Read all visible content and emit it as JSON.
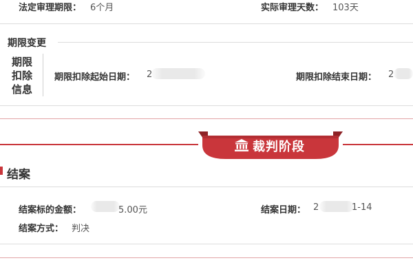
{
  "top": {
    "legal_period_label": "法定审理期限：",
    "legal_period_value": "6个月",
    "actual_days_label": "实际审理天数：",
    "actual_days_value": "103天"
  },
  "period_change": {
    "title": "期限变更",
    "side_label": [
      "期限",
      "扣除",
      "信息"
    ],
    "deduct_start_label": "期限扣除起始日期：",
    "deduct_start_value": "2",
    "deduct_end_label": "期限扣除结束日期：",
    "deduct_end_value": "2"
  },
  "stage_banner": {
    "label": "裁判阶段",
    "icon": "courthouse-icon"
  },
  "closing": {
    "title": "结案",
    "amount_label": "结案标的金额：",
    "amount_value_tail": "5.00元",
    "date_label": "结案日期：",
    "date_value_head": "2",
    "date_value_tail": "1-14",
    "method_label": "结案方式：",
    "method_value": "判决"
  },
  "colors": {
    "accent_red": "#c9363b",
    "banner_dark": "#a82a2f"
  }
}
